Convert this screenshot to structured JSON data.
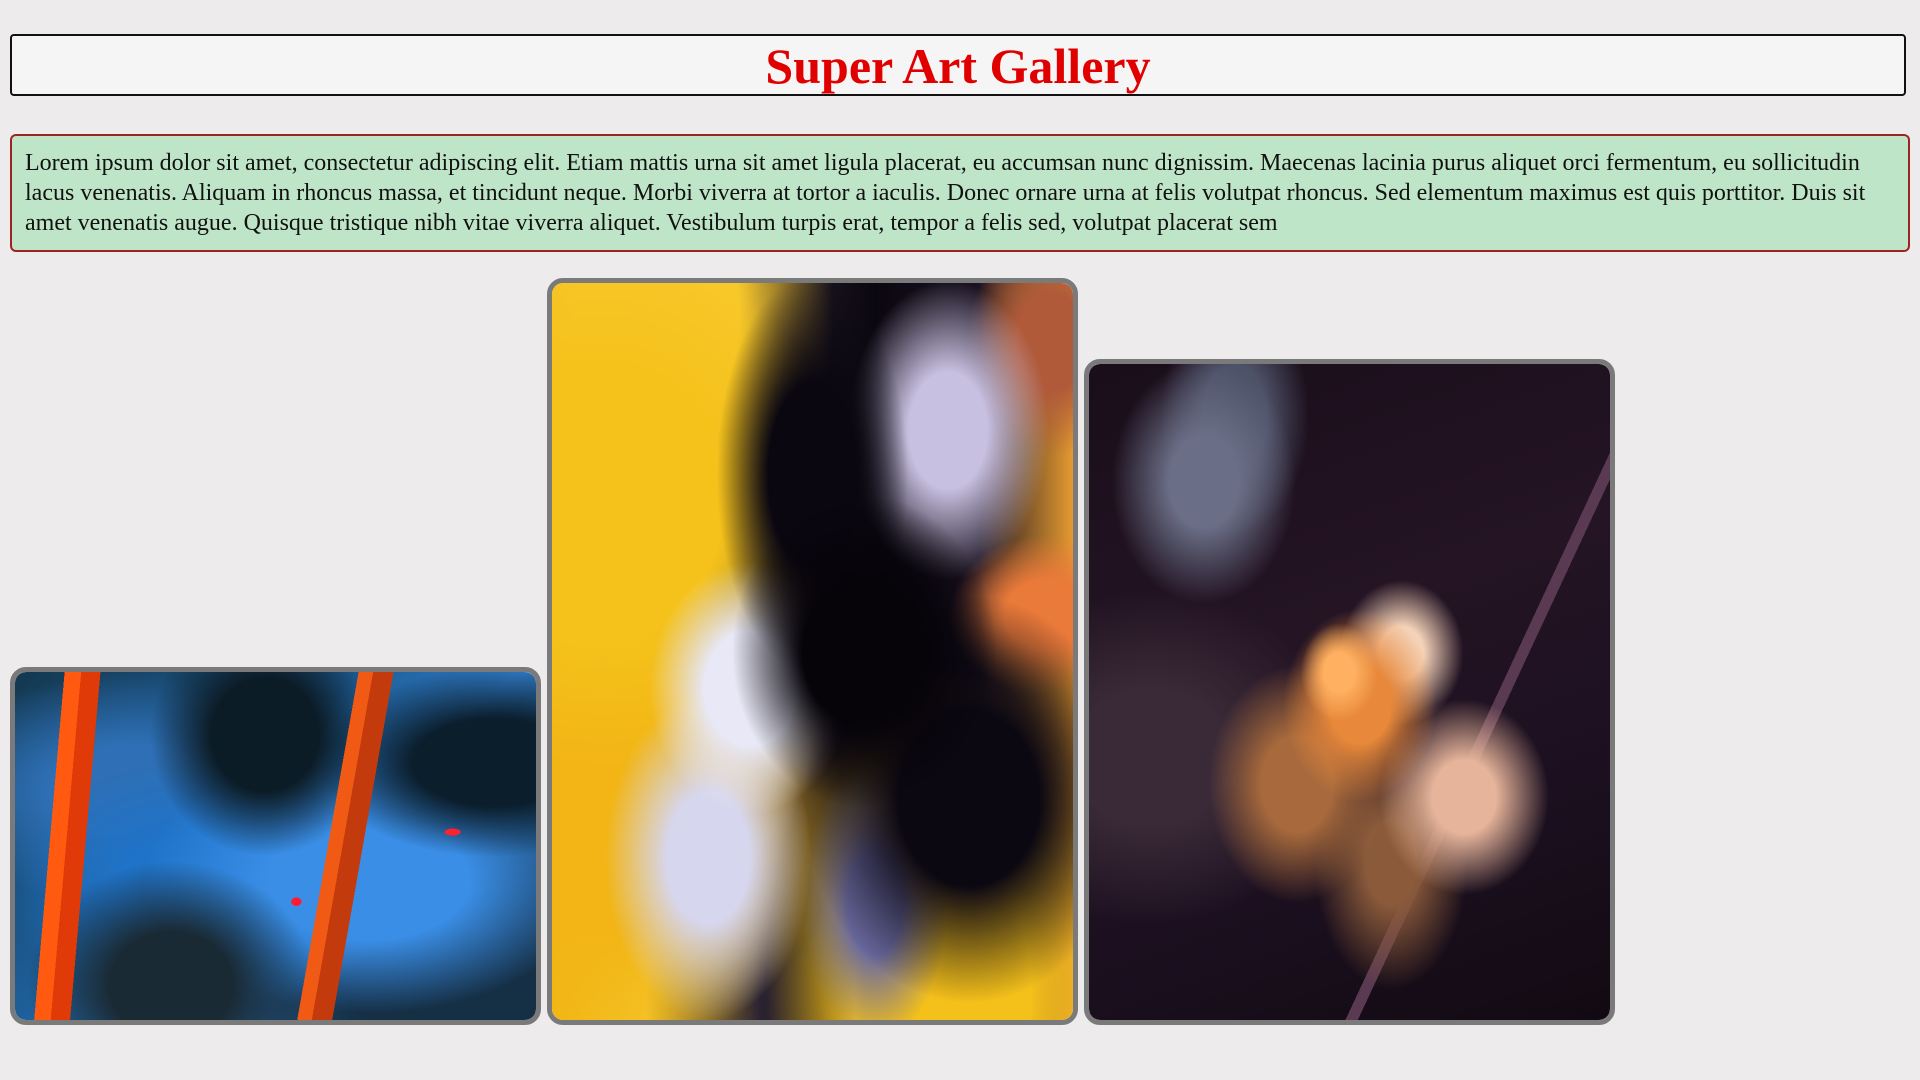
{
  "header": {
    "title": "Super Art Gallery"
  },
  "intro": {
    "text": "Lorem ipsum dolor sit amet, consectetur adipiscing elit. Etiam mattis urna sit amet ligula placerat, eu accumsan nunc dignissim. Maecenas lacinia purus aliquet orci fermentum, eu sollicitudin lacus venenatis. Aliquam in rhoncus massa, et tincidunt neque. Morbi viverra at tortor a iaculis. Donec ornare urna at felis volutpat rhoncus. Sed elementum maximus est quis porttitor. Duis sit amet venenatis augue. Quisque tristique nibh vitae viverra aliquet. Vestibulum turpis erat, tempor a felis sed, volutpat placerat sem"
  },
  "colors": {
    "title": "#e00000",
    "intro_background": "#bfe5c8",
    "intro_border": "#9c2424",
    "page_background": "#edebec",
    "frame_border": "#7a7a7a"
  },
  "gallery": {
    "artworks": [
      {
        "name": "abstract-blue-orange-painting"
      },
      {
        "name": "abstract-yellow-black-fluid-painting"
      },
      {
        "name": "abstract-orange-nebula-painting"
      }
    ]
  }
}
